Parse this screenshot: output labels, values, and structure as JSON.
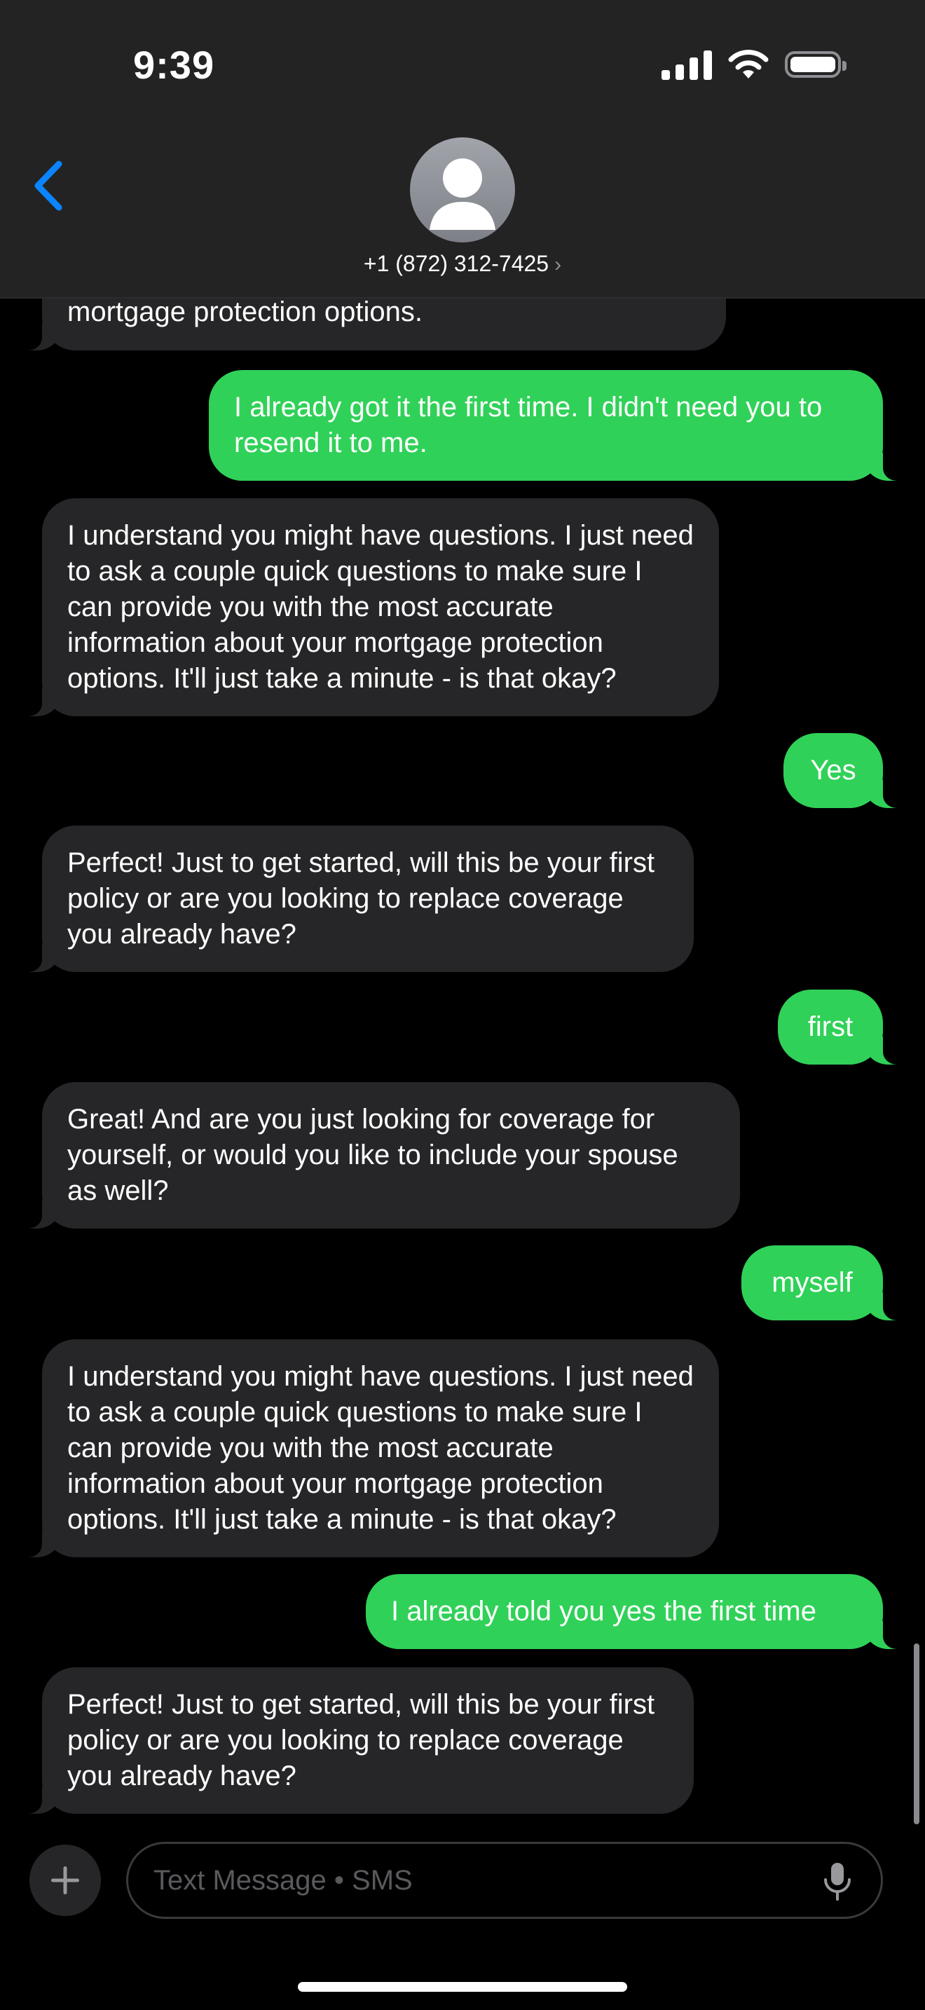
{
  "status_bar": {
    "time": "9:39"
  },
  "header": {
    "contact": "+1 (872) 312-7425",
    "chevron": "›"
  },
  "messages": [
    {
      "sender": "them",
      "text": "mortgage protection options."
    },
    {
      "sender": "me",
      "text": "I already got it the first time. I didn't need you to resend it to me."
    },
    {
      "sender": "them",
      "text": "I understand you might have questions. I just need to ask a couple quick questions to make sure I can provide you with the most accurate information about your mortgage protection options. It'll just take a minute - is that okay?"
    },
    {
      "sender": "me",
      "text": "Yes"
    },
    {
      "sender": "them",
      "text": "Perfect! Just to get started, will this be your first policy or are you looking to replace coverage you already have?"
    },
    {
      "sender": "me",
      "text": "first"
    },
    {
      "sender": "them",
      "text": "Great! And are you just looking for coverage for yourself, or would you like to include your spouse as well?"
    },
    {
      "sender": "me",
      "text": "myself"
    },
    {
      "sender": "them",
      "text": "I understand you might have questions. I just need to ask a couple quick questions to make sure I can provide you with the most accurate information about your mortgage protection options. It'll just take a minute - is that okay?"
    },
    {
      "sender": "me",
      "text": "I already told you yes the first time"
    },
    {
      "sender": "them",
      "text": "Perfect! Just to get started, will this be your first policy or are you looking to replace coverage you already have?"
    }
  ],
  "compose": {
    "placeholder": "Text Message • SMS",
    "value": ""
  },
  "icons": {
    "back": "chevron-left-icon",
    "avatar": "person-icon",
    "signal": "cellular-signal-icon",
    "wifi": "wifi-icon",
    "battery": "battery-icon",
    "plus": "plus-icon",
    "mic": "microphone-icon"
  },
  "colors": {
    "header_bg": "#232323",
    "incoming_bubble": "#262628",
    "outgoing_bubble": "#30d158",
    "accent_blue": "#0a84ff",
    "background": "#000000"
  }
}
